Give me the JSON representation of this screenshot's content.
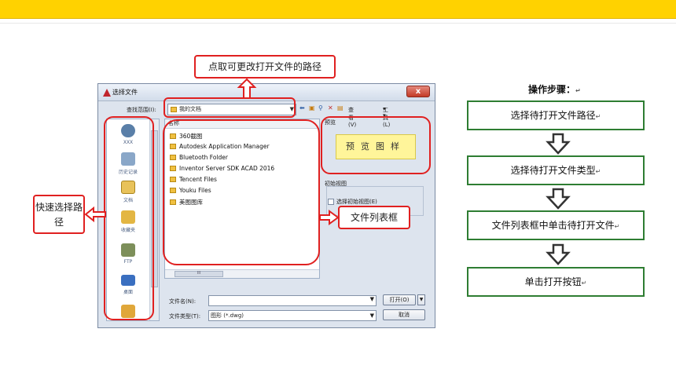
{
  "dialog": {
    "title": "选择文件",
    "close_label": "x",
    "look_in_label": "查找范围(I):",
    "look_in_value": "我的文档",
    "toolbar": {
      "view_label": "查看(V)",
      "tools_label": "工具(L)"
    },
    "places": [
      {
        "label": "XXX",
        "icon": "cloud-icon"
      },
      {
        "label": "历史记录",
        "icon": "history-icon"
      },
      {
        "label": "文档",
        "icon": "documents-icon"
      },
      {
        "label": "收藏夹",
        "icon": "favorites-icon"
      },
      {
        "label": "FTP",
        "icon": "ftp-icon"
      },
      {
        "label": "桌面",
        "icon": "desktop-icon"
      }
    ],
    "file_list": {
      "column_name": "名称",
      "items": [
        "360截图",
        "Autodesk Application Manager",
        "Bluetooth Folder",
        "Inventor Server SDK ACAD 2016",
        "Tencent Files",
        "Youku Files",
        "美图图库"
      ],
      "scroll_grip": "III"
    },
    "preview_label": "预览",
    "preview_placeholder": "预览图样",
    "initial_view_label": "初始视图",
    "select_initial_view_label": "选择初始视图(E)",
    "file_name_label": "文件名(N):",
    "file_name_value": "",
    "file_type_label": "文件类型(T):",
    "file_type_value": "图形 (*.dwg)",
    "open_button": "打开(O)",
    "cancel_button": "取消"
  },
  "annotations": {
    "path_note": "点取可更改打开文件的路径",
    "quick_path_note": "快速选择路径",
    "file_list_note": "文件列表框"
  },
  "steps": {
    "title": "操作步骤：",
    "items": [
      "选择待打开文件路径",
      "选择待打开文件类型",
      "文件列表框中单击待打开文件",
      "单击打开按钮"
    ]
  },
  "colors": {
    "top_bar": "#ffd200",
    "annotation_red": "#e02020",
    "step_border": "#2e7d32",
    "preview_fill": "#fff59a"
  }
}
